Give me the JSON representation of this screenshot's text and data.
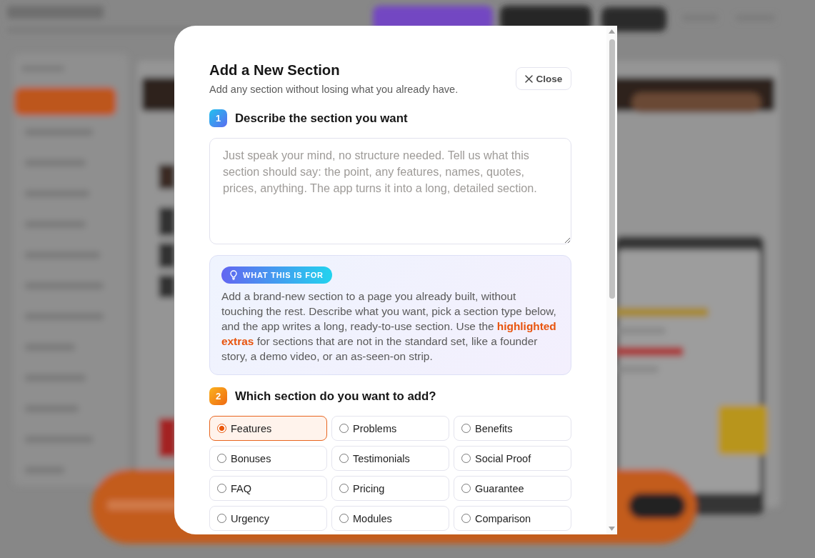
{
  "dialog": {
    "title": "Add a New Section",
    "subtitle": "Add any section without losing what you already have.",
    "close_button": "Close",
    "describe_step": {
      "number": "1",
      "heading": "Describe the section you want",
      "description_field": {
        "placeholder": "Just speak your mind, no structure needed. Tell us what this section should say: the point, any features, names, quotes, prices, anything. The app turns it into a long, detailed section."
      }
    },
    "info_box": {
      "badge": "WHAT THIS IS FOR",
      "text": "Add a brand-new section to a page you already built, without touching the rest. Describe what you want, pick a section type below, and the app writes a long, ready-to-use section. Use the **highlighted extras** for sections that are not in the standard set, like a founder story, a demo video, or an as-seen-on strip."
    },
    "section_step": {
      "number": "2",
      "heading": "Which section do you want to add?",
      "options": [
        {
          "label": "Features",
          "selected": true
        },
        {
          "label": "Problems",
          "selected": false
        },
        {
          "label": "Benefits",
          "selected": false
        },
        {
          "label": "Bonuses",
          "selected": false
        },
        {
          "label": "Testimonials",
          "selected": false
        },
        {
          "label": "Social Proof",
          "selected": false
        },
        {
          "label": "FAQ",
          "selected": false
        },
        {
          "label": "Pricing",
          "selected": false
        },
        {
          "label": "Guarantee",
          "selected": false
        },
        {
          "label": "Urgency",
          "selected": false
        },
        {
          "label": "Modules",
          "selected": false
        },
        {
          "label": "Comparison",
          "selected": false
        }
      ]
    }
  }
}
